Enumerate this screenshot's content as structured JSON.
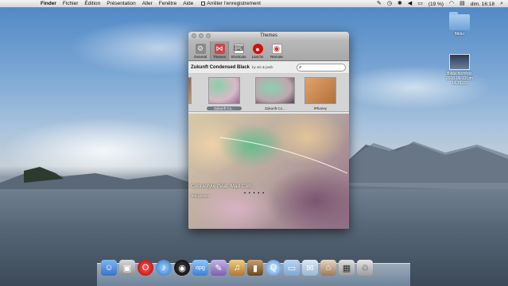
{
  "menubar": {
    "items": [
      "Finder",
      "Fichier",
      "Édition",
      "Présentation",
      "Aller",
      "Fenêtre",
      "Aide"
    ],
    "recording_label": "Arrêter l'enregistrement",
    "battery": "(19 %)",
    "datetime": "dim. 16:18"
  },
  "desktop_icons": [
    {
      "label": "Bilder",
      "type": "folder"
    },
    {
      "label": "Bildschirmfoto 2010-06-13 um 14.21.03",
      "type": "screenshot"
    }
  ],
  "window": {
    "title": "Themes",
    "toolbar": [
      "General",
      "Themes",
      "Shortcuts",
      "Last.fm",
      "Remote"
    ],
    "active_tab": "Themes",
    "theme_name": "Zukunft Condensed Black",
    "theme_author": "by alx & janik",
    "thumbnails": [
      {
        "label": "Zukunft Co...",
        "selected": true
      },
      {
        "label": "Zukunft Co...",
        "selected": false
      },
      {
        "label": "iPhoney",
        "selected": false
      }
    ],
    "track_title": "Cobrastyle (feat. Mad Cob...",
    "track_artist": "Teddybears",
    "rating": "• • • • •"
  },
  "dock": {
    "items": [
      "finder",
      "preview",
      "opera",
      "itunes",
      "camera",
      "app-opg",
      "script-editor",
      "firewire",
      "photo-booth",
      "quicktime",
      "folder",
      "mail",
      "home",
      "calculator",
      "trash"
    ]
  },
  "colors": {
    "menubar": "#e4e4e4",
    "window_bg": "#e8e8e8",
    "accent_selected": "#6d7a8a"
  }
}
